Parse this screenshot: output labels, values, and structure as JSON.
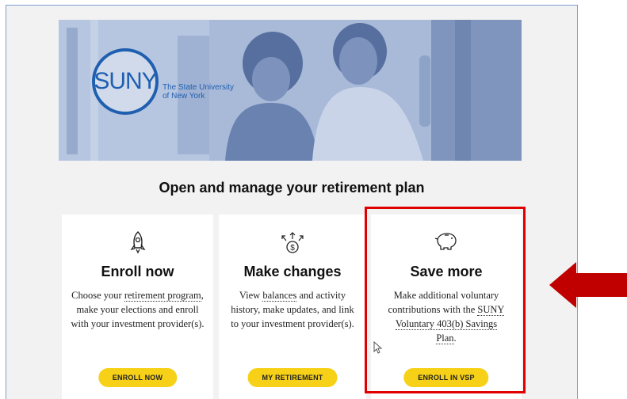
{
  "hero": {
    "logo_mark": "SUNY",
    "logo_line1": "The State University",
    "logo_line2": "of New York"
  },
  "heading": "Open and manage your retirement plan",
  "cards": [
    {
      "icon": "rocket-icon",
      "title": "Enroll now",
      "desc_1": "Choose your ",
      "desc_link": "retirement program",
      "desc_2": ", make your elections and enroll with your investment provider(s).",
      "button": "ENROLL NOW"
    },
    {
      "icon": "money-arrows-icon",
      "title": "Make changes",
      "desc_1": "View ",
      "desc_link": "balances",
      "desc_2": " and activity history, make updates, and link to your investment provider(s).",
      "button": "MY RETIREMENT"
    },
    {
      "icon": "piggy-bank-icon",
      "title": "Save more",
      "desc_1": "Make additional voluntary contributions with the ",
      "desc_link": "SUNY Voluntary 403(b) Savings Plan",
      "desc_2": ".",
      "button": "ENROLL IN VSP"
    }
  ],
  "colors": {
    "button": "#f7d117",
    "highlight": "#e00000",
    "arrow": "#c00000",
    "brand": "#1f5fb0"
  }
}
